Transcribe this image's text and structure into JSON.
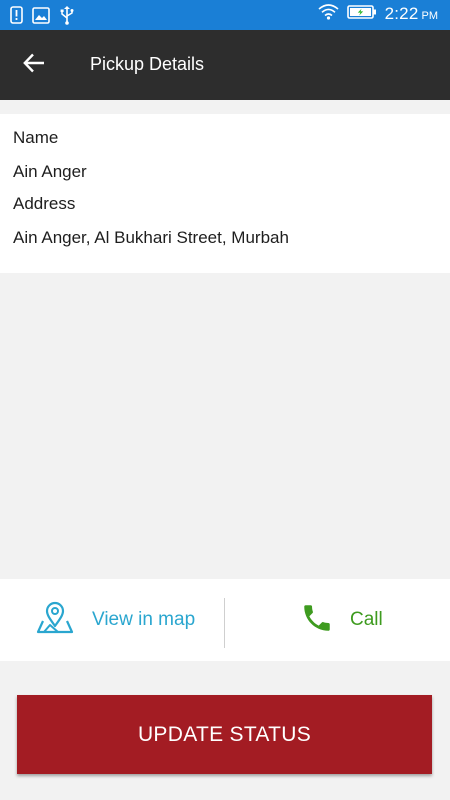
{
  "status_bar": {
    "time": "2:22",
    "ampm": "PM",
    "left_icons": [
      "notification-icon",
      "image-icon",
      "usb-icon"
    ],
    "right_icons": [
      "wifi-icon",
      "battery-charging-icon"
    ],
    "color": "#1a7fd6"
  },
  "toolbar": {
    "title": "Pickup Details",
    "back_icon": "back-arrow-icon",
    "color": "#2d2d2d"
  },
  "details": {
    "name_label": "Name",
    "name_value": "Ain Anger",
    "address_label": "Address",
    "address_value": "Ain Anger, Al Bukhari Street, Murbah"
  },
  "actions": {
    "map": {
      "label": "View in map",
      "icon": "map-pin-icon",
      "color": "#2aa6cf"
    },
    "call": {
      "label": "Call",
      "icon": "phone-icon",
      "color": "#3e9b1f"
    }
  },
  "update_button": {
    "label": "UPDATE STATUS",
    "color": "#a31c23"
  }
}
